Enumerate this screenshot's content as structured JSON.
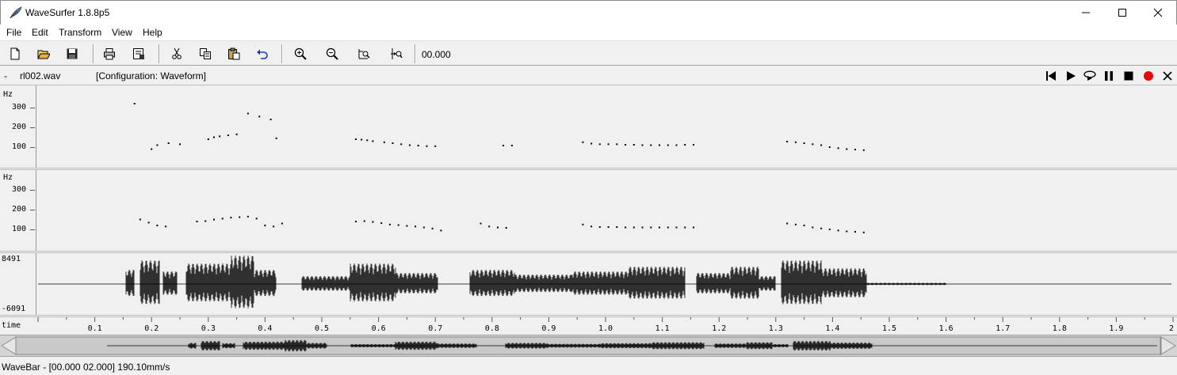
{
  "window": {
    "title": "WaveSurfer 1.8.8p5"
  },
  "menu": [
    "File",
    "Edit",
    "Transform",
    "View",
    "Help"
  ],
  "toolbar": {
    "time_readout": "00.000"
  },
  "soundbar": {
    "dash": "-",
    "filename": "rl002.wav",
    "configuration": "[Configuration: Waveform]"
  },
  "pitch_pane_1": {
    "unit": "Hz",
    "ticks": [
      "300",
      "200",
      "100"
    ]
  },
  "pitch_pane_2": {
    "unit": "Hz",
    "ticks": [
      "300",
      "200",
      "100"
    ]
  },
  "waveform_pane": {
    "max_label": "8491",
    "min_label": "-6091"
  },
  "timeaxis": {
    "label": "time",
    "ticks": [
      "0.1",
      "0.2",
      "0.3",
      "0.4",
      "0.5",
      "0.6",
      "0.7",
      "0.8",
      "0.9",
      "1.0",
      "1.1",
      "1.2",
      "1.3",
      "1.4",
      "1.5",
      "1.6",
      "1.7",
      "1.8",
      "1.9",
      "2"
    ]
  },
  "statusbar": {
    "text": "WaveBar - [00.000 02.000] 190.10mm/s"
  },
  "chart_data": [
    {
      "type": "scatter",
      "title": "",
      "xlabel": "time",
      "ylabel": "Hz",
      "xlim": [
        0,
        2
      ],
      "ylim": [
        0,
        400
      ],
      "series": [
        {
          "x": [
            0.17,
            0.2,
            0.21,
            0.23,
            0.25,
            0.3,
            0.31,
            0.32,
            0.335,
            0.35,
            0.37,
            0.39,
            0.41,
            0.42,
            0.56,
            0.57,
            0.58,
            0.59,
            0.61,
            0.625,
            0.64,
            0.655,
            0.67,
            0.685,
            0.7,
            0.82,
            0.835,
            0.96,
            0.975,
            0.99,
            1.005,
            1.02,
            1.035,
            1.05,
            1.065,
            1.08,
            1.095,
            1.11,
            1.125,
            1.14,
            1.155,
            1.32,
            1.335,
            1.35,
            1.365,
            1.38,
            1.395,
            1.41,
            1.425,
            1.44,
            1.455
          ],
          "y": [
            320,
            90,
            110,
            120,
            115,
            140,
            150,
            155,
            160,
            165,
            270,
            255,
            240,
            145,
            140,
            138,
            135,
            130,
            125,
            120,
            115,
            110,
            108,
            105,
            105,
            108,
            108,
            125,
            118,
            115,
            115,
            115,
            112,
            112,
            110,
            110,
            110,
            110,
            110,
            112,
            112,
            128,
            125,
            120,
            115,
            110,
            100,
            95,
            90,
            88,
            85
          ]
        }
      ]
    },
    {
      "type": "scatter",
      "title": "",
      "xlabel": "time",
      "ylabel": "Hz",
      "xlim": [
        0,
        2
      ],
      "ylim": [
        0,
        400
      ],
      "series": [
        {
          "x": [
            0.18,
            0.195,
            0.21,
            0.225,
            0.28,
            0.295,
            0.31,
            0.325,
            0.34,
            0.355,
            0.37,
            0.385,
            0.4,
            0.415,
            0.43,
            0.56,
            0.575,
            0.59,
            0.605,
            0.62,
            0.635,
            0.65,
            0.665,
            0.68,
            0.695,
            0.71,
            0.78,
            0.795,
            0.81,
            0.825,
            0.96,
            0.975,
            0.99,
            1.005,
            1.02,
            1.035,
            1.05,
            1.065,
            1.08,
            1.095,
            1.11,
            1.125,
            1.14,
            1.155,
            1.32,
            1.335,
            1.35,
            1.365,
            1.38,
            1.395,
            1.41,
            1.425,
            1.44,
            1.455
          ],
          "y": [
            150,
            135,
            120,
            115,
            140,
            142,
            150,
            155,
            160,
            162,
            165,
            155,
            120,
            115,
            130,
            140,
            142,
            138,
            132,
            125,
            122,
            118,
            115,
            110,
            105,
            95,
            130,
            115,
            110,
            108,
            125,
            115,
            112,
            112,
            112,
            110,
            110,
            110,
            110,
            110,
            110,
            110,
            110,
            110,
            130,
            125,
            120,
            110,
            105,
            100,
            95,
            90,
            88,
            85
          ]
        }
      ]
    }
  ]
}
